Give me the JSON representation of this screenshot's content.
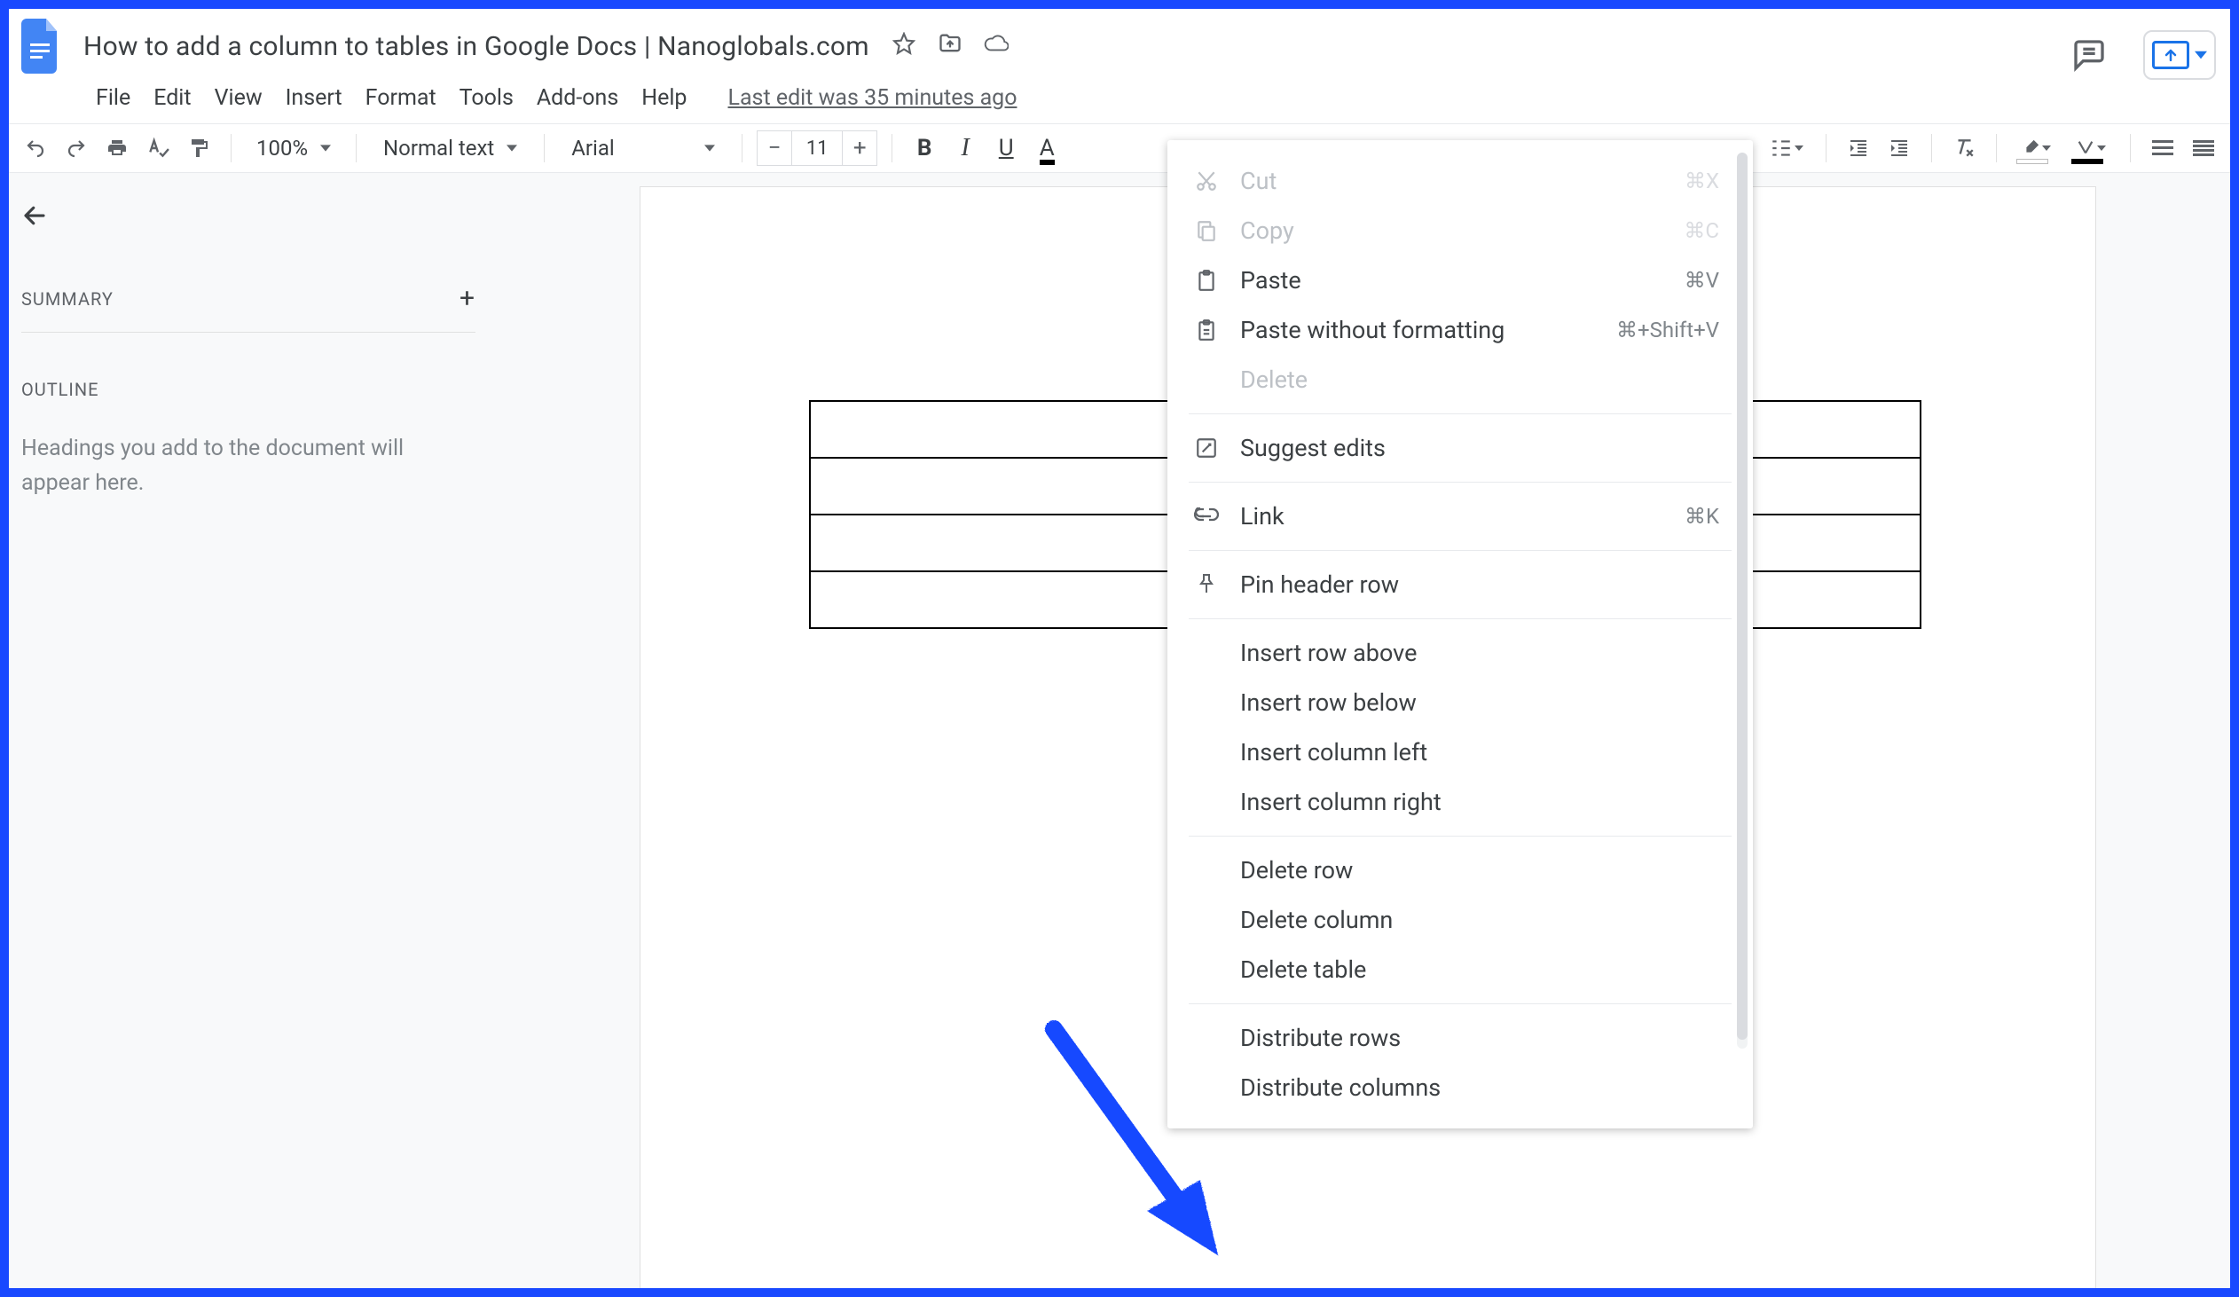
{
  "doc": {
    "title": "How to add a column to tables in Google Docs | Nanoglobals.com",
    "last_edit": "Last edit was 35 minutes ago"
  },
  "menubar": {
    "file": "File",
    "edit": "Edit",
    "view": "View",
    "insert": "Insert",
    "format": "Format",
    "tools": "Tools",
    "addons": "Add-ons",
    "help": "Help"
  },
  "toolbar": {
    "zoom": "100%",
    "style": "Normal text",
    "font": "Arial",
    "font_size": "11"
  },
  "sidebar": {
    "summary_title": "SUMMARY",
    "outline_title": "OUTLINE",
    "outline_placeholder": "Headings you add to the document will appear here."
  },
  "context_menu": {
    "cut": {
      "label": "Cut",
      "shortcut": "⌘X"
    },
    "copy": {
      "label": "Copy",
      "shortcut": "⌘C"
    },
    "paste": {
      "label": "Paste",
      "shortcut": "⌘V"
    },
    "paste_plain": {
      "label": "Paste without formatting",
      "shortcut": "⌘+Shift+V"
    },
    "delete": {
      "label": "Delete"
    },
    "suggest": {
      "label": "Suggest edits"
    },
    "link": {
      "label": "Link",
      "shortcut": "⌘K"
    },
    "pin_header": {
      "label": "Pin header row"
    },
    "insert_row_above": {
      "label": "Insert row above"
    },
    "insert_row_below": {
      "label": "Insert row below"
    },
    "insert_col_left": {
      "label": "Insert column left"
    },
    "insert_col_right": {
      "label": "Insert column right"
    },
    "delete_row": {
      "label": "Delete row"
    },
    "delete_col": {
      "label": "Delete column"
    },
    "delete_table": {
      "label": "Delete table"
    },
    "dist_rows": {
      "label": "Distribute rows"
    },
    "dist_cols": {
      "label": "Distribute columns"
    }
  }
}
